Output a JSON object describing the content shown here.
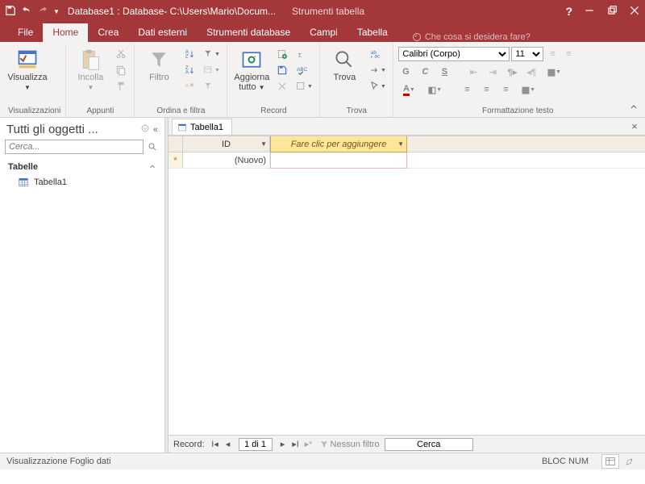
{
  "titlebar": {
    "title": "Database1 : Database- C:\\Users\\Mario\\Docum...",
    "context_title": "Strumenti tabella"
  },
  "tabs": {
    "file": "File",
    "home": "Home",
    "crea": "Crea",
    "dati_esterni": "Dati esterni",
    "strumenti_db": "Strumenti database",
    "campi": "Campi",
    "tabella": "Tabella",
    "tell_me": "Che cosa si desidera fare?"
  },
  "ribbon": {
    "visualizza": {
      "label": "Visualizza",
      "group": "Visualizzazioni"
    },
    "incolla": {
      "label": "Incolla",
      "group": "Appunti"
    },
    "filtro": {
      "label": "Filtro",
      "group": "Ordina e filtra"
    },
    "aggiorna": {
      "label": "Aggiorna\ntutto",
      "group": "Record"
    },
    "trova": {
      "label": "Trova",
      "group": "Trova"
    },
    "font": {
      "name": "Calibri (Corpo)",
      "size": "11",
      "group": "Formattazione testo"
    }
  },
  "navpane": {
    "title": "Tutti gli oggetti ...",
    "search_placeholder": "Cerca...",
    "group": "Tabelle",
    "item1": "Tabella1"
  },
  "doctab": {
    "label": "Tabella1"
  },
  "datasheet": {
    "col_id": "ID",
    "col_add": "Fare clic per aggiungere",
    "row_new": "(Nuovo)"
  },
  "recordnav": {
    "label": "Record:",
    "pos": "1 di 1",
    "filter": "Nessun filtro",
    "search": "Cerca"
  },
  "statusbar": {
    "mode": "Visualizzazione Foglio dati",
    "lock": "BLOC NUM"
  }
}
